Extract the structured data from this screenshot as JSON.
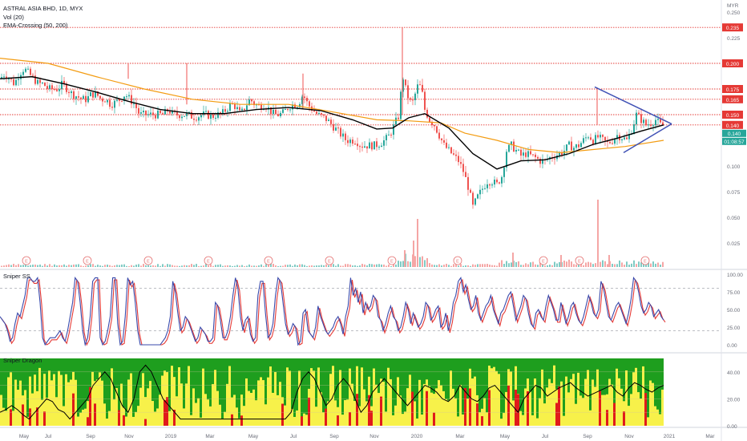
{
  "legend": {
    "symbol": "ASTRAL ASIA BHD, 1D, MYX",
    "vol": "Vol (20)",
    "ema": "EMA-Crossing (50, 200)",
    "sniper": "Sniper SS",
    "dragon": "Sniper Dragon"
  },
  "price_axis": {
    "currency": "MYR",
    "ticks": [
      "0.250",
      "0.225",
      "0.200",
      "0.175",
      "0.150",
      "0.125",
      "0.100",
      "0.075",
      "0.050",
      "0.025"
    ],
    "tick_values": [
      0.25,
      0.225,
      0.2,
      0.175,
      0.15,
      0.125,
      0.1,
      0.075,
      0.05,
      0.025
    ],
    "current_price": "0.140",
    "countdown": "01:08:57"
  },
  "sniper_axis": {
    "ticks": [
      "100.00",
      "75.00",
      "50.00",
      "25.00",
      "0.00"
    ],
    "tick_values": [
      100,
      75,
      50,
      25,
      0
    ]
  },
  "dragon_axis": {
    "ticks": [
      "40.00",
      "20.00",
      "0.00"
    ],
    "tick_values": [
      40,
      20,
      0
    ]
  },
  "time_axis": {
    "labels": [
      "May",
      "Jul",
      "Sep",
      "Nov",
      "2019",
      "Mar",
      "May",
      "Jul",
      "Sep",
      "Nov",
      "2020",
      "Mar",
      "May",
      "Jul",
      "Sep",
      "Nov",
      "2021",
      "Mar"
    ]
  },
  "earnings_marker": "E",
  "colors": {
    "up": "#26a69a",
    "down": "#ef5350",
    "ema_fast": "#000000",
    "ema_slow": "#f39c12",
    "level": "#e53935",
    "trend": "#3f51b5",
    "sniper_a": "#3949ab",
    "sniper_b": "#e53935",
    "dragon_green": "#1e9e1e",
    "dragon_yellow": "#f7f14a",
    "dragon_red": "#e01b1b",
    "price_badge": "#26a69a"
  },
  "chart_data": [
    {
      "type": "candlestick",
      "title": "ASTRAL ASIA BHD, 1D, MYX",
      "ylim": [
        0,
        0.25
      ],
      "levels": [
        {
          "value": 0.235,
          "label": "0.235"
        },
        {
          "value": 0.2,
          "label": "0.200"
        },
        {
          "value": 0.175,
          "label": "0.175"
        },
        {
          "value": 0.165,
          "label": "0.165"
        },
        {
          "value": 0.15,
          "label": "0.150"
        },
        {
          "value": 0.14,
          "label": "0.140"
        }
      ],
      "close_series": [
        [
          0,
          0.185
        ],
        [
          6,
          0.19
        ],
        [
          12,
          0.185
        ],
        [
          18,
          0.18
        ],
        [
          24,
          0.19
        ],
        [
          30,
          0.195
        ],
        [
          36,
          0.19
        ],
        [
          42,
          0.185
        ],
        [
          48,
          0.18
        ],
        [
          54,
          0.18
        ],
        [
          60,
          0.175
        ],
        [
          66,
          0.175
        ],
        [
          72,
          0.175
        ],
        [
          78,
          0.18
        ],
        [
          84,
          0.175
        ],
        [
          90,
          0.17
        ],
        [
          96,
          0.168
        ],
        [
          102,
          0.165
        ],
        [
          108,
          0.165
        ],
        [
          114,
          0.17
        ],
        [
          120,
          0.17
        ],
        [
          126,
          0.165
        ],
        [
          132,
          0.165
        ],
        [
          138,
          0.16
        ],
        [
          144,
          0.162
        ],
        [
          150,
          0.165
        ],
        [
          156,
          0.17
        ],
        [
          162,
          0.165
        ],
        [
          168,
          0.16
        ],
        [
          174,
          0.15
        ],
        [
          180,
          0.15
        ],
        [
          186,
          0.15
        ],
        [
          192,
          0.15
        ],
        [
          198,
          0.15
        ],
        [
          204,
          0.15
        ],
        [
          210,
          0.155
        ],
        [
          216,
          0.15
        ],
        [
          222,
          0.15
        ],
        [
          228,
          0.15
        ],
        [
          234,
          0.15
        ],
        [
          240,
          0.148
        ],
        [
          246,
          0.148
        ],
        [
          252,
          0.15
        ],
        [
          258,
          0.15
        ],
        [
          264,
          0.148
        ],
        [
          270,
          0.15
        ],
        [
          276,
          0.15
        ],
        [
          282,
          0.155
        ],
        [
          288,
          0.16
        ],
        [
          294,
          0.158
        ],
        [
          300,
          0.15
        ],
        [
          306,
          0.158
        ],
        [
          312,
          0.165
        ],
        [
          318,
          0.16
        ],
        [
          324,
          0.158
        ],
        [
          330,
          0.16
        ],
        [
          336,
          0.155
        ],
        [
          342,
          0.15
        ],
        [
          348,
          0.15
        ],
        [
          354,
          0.152
        ],
        [
          360,
          0.158
        ],
        [
          366,
          0.16
        ],
        [
          372,
          0.16
        ],
        [
          378,
          0.17
        ],
        [
          384,
          0.16
        ],
        [
          390,
          0.155
        ],
        [
          396,
          0.15
        ],
        [
          402,
          0.148
        ],
        [
          408,
          0.145
        ],
        [
          414,
          0.14
        ],
        [
          420,
          0.135
        ],
        [
          426,
          0.13
        ],
        [
          432,
          0.125
        ],
        [
          438,
          0.125
        ],
        [
          444,
          0.125
        ],
        [
          450,
          0.12
        ],
        [
          456,
          0.12
        ],
        [
          462,
          0.12
        ],
        [
          468,
          0.12
        ],
        [
          474,
          0.122
        ],
        [
          480,
          0.125
        ],
        [
          486,
          0.13
        ],
        [
          492,
          0.14
        ],
        [
          498,
          0.15
        ],
        [
          502,
          0.19
        ],
        [
          506,
          0.175
        ],
        [
          510,
          0.165
        ],
        [
          514,
          0.16
        ],
        [
          518,
          0.17
        ],
        [
          522,
          0.18
        ],
        [
          526,
          0.175
        ],
        [
          530,
          0.155
        ],
        [
          536,
          0.145
        ],
        [
          542,
          0.14
        ],
        [
          548,
          0.13
        ],
        [
          554,
          0.12
        ],
        [
          560,
          0.115
        ],
        [
          566,
          0.11
        ],
        [
          572,
          0.105
        ],
        [
          578,
          0.095
        ],
        [
          584,
          0.08
        ],
        [
          590,
          0.06
        ],
        [
          596,
          0.07
        ],
        [
          602,
          0.078
        ],
        [
          608,
          0.085
        ],
        [
          614,
          0.085
        ],
        [
          620,
          0.082
        ],
        [
          626,
          0.09
        ],
        [
          632,
          0.115
        ],
        [
          638,
          0.12
        ],
        [
          644,
          0.115
        ],
        [
          650,
          0.11
        ],
        [
          656,
          0.112
        ],
        [
          662,
          0.11
        ],
        [
          668,
          0.108
        ],
        [
          674,
          0.105
        ],
        [
          680,
          0.105
        ],
        [
          686,
          0.108
        ],
        [
          692,
          0.11
        ],
        [
          698,
          0.112
        ],
        [
          704,
          0.115
        ],
        [
          710,
          0.12
        ],
        [
          716,
          0.118
        ],
        [
          722,
          0.12
        ],
        [
          728,
          0.125
        ],
        [
          734,
          0.13
        ],
        [
          740,
          0.125
        ],
        [
          746,
          0.128
        ],
        [
          752,
          0.125
        ],
        [
          758,
          0.122
        ],
        [
          764,
          0.125
        ],
        [
          770,
          0.13
        ],
        [
          776,
          0.128
        ],
        [
          782,
          0.125
        ],
        [
          788,
          0.135
        ],
        [
          794,
          0.15
        ],
        [
          800,
          0.145
        ],
        [
          806,
          0.14
        ],
        [
          812,
          0.142
        ],
        [
          818,
          0.145
        ],
        [
          824,
          0.14
        ],
        [
          828,
          0.14
        ]
      ],
      "ema_50": [
        [
          0,
          0.185
        ],
        [
          40,
          0.187
        ],
        [
          80,
          0.18
        ],
        [
          120,
          0.172
        ],
        [
          160,
          0.163
        ],
        [
          200,
          0.155
        ],
        [
          240,
          0.151
        ],
        [
          280,
          0.151
        ],
        [
          320,
          0.155
        ],
        [
          360,
          0.157
        ],
        [
          400,
          0.154
        ],
        [
          440,
          0.145
        ],
        [
          470,
          0.136
        ],
        [
          490,
          0.137
        ],
        [
          510,
          0.147
        ],
        [
          530,
          0.151
        ],
        [
          560,
          0.137
        ],
        [
          590,
          0.112
        ],
        [
          620,
          0.097
        ],
        [
          650,
          0.105
        ],
        [
          680,
          0.106
        ],
        [
          710,
          0.112
        ],
        [
          740,
          0.121
        ],
        [
          770,
          0.127
        ],
        [
          800,
          0.134
        ],
        [
          828,
          0.14
        ]
      ],
      "ema_200": [
        [
          0,
          0.205
        ],
        [
          60,
          0.2
        ],
        [
          120,
          0.187
        ],
        [
          180,
          0.175
        ],
        [
          240,
          0.165
        ],
        [
          300,
          0.16
        ],
        [
          360,
          0.16
        ],
        [
          420,
          0.152
        ],
        [
          470,
          0.145
        ],
        [
          510,
          0.144
        ],
        [
          550,
          0.142
        ],
        [
          580,
          0.132
        ],
        [
          620,
          0.125
        ],
        [
          660,
          0.116
        ],
        [
          700,
          0.113
        ],
        [
          740,
          0.116
        ],
        [
          780,
          0.119
        ],
        [
          828,
          0.125
        ]
      ],
      "trendlines": [
        {
          "from": [
            742,
            0.177
          ],
          "to": [
            838,
            0.141
          ]
        },
        {
          "from": [
            778,
            0.113
          ],
          "to": [
            838,
            0.141
          ]
        }
      ]
    },
    {
      "type": "bar",
      "title": "Vol (20)",
      "spikes": [
        {
          "x": 521,
          "v": 1.0
        },
        {
          "x": 516,
          "v": 0.55
        },
        {
          "x": 746,
          "v": 1.4
        },
        {
          "x": 505,
          "v": 0.35
        },
        {
          "x": 640,
          "v": 0.3
        },
        {
          "x": 700,
          "v": 0.25
        },
        {
          "x": 760,
          "v": 0.25
        }
      ]
    },
    {
      "type": "line",
      "title": "Sniper SS",
      "ylim": [
        0,
        100
      ],
      "values": [
        40,
        35,
        30,
        20,
        5,
        10,
        30,
        45,
        40,
        55,
        70,
        95,
        95,
        90,
        90,
        95,
        60,
        10,
        0,
        5,
        10,
        10,
        10,
        15,
        20,
        10,
        5,
        20,
        40,
        60,
        95,
        90,
        60,
        20,
        0,
        10,
        40,
        90,
        95,
        95,
        10,
        0,
        5,
        20,
        40,
        95,
        95,
        30,
        0,
        5,
        40,
        95,
        85,
        90,
        60,
        20,
        0,
        0,
        0,
        0,
        0,
        0,
        0,
        0,
        0,
        5,
        10,
        20,
        40,
        90,
        75,
        45,
        20,
        25,
        40,
        35,
        25,
        15,
        5,
        10,
        25,
        20,
        15,
        5,
        5,
        10,
        60,
        55,
        35,
        10,
        10,
        20,
        40,
        70,
        95,
        80,
        40,
        20,
        35,
        40,
        15,
        5,
        10,
        70,
        90,
        90,
        45,
        10,
        15,
        30,
        70,
        95,
        90,
        60,
        30,
        15,
        20,
        30,
        25,
        0,
        5,
        45,
        50,
        20,
        15,
        10,
        25,
        55,
        40,
        30,
        20,
        15,
        20,
        25,
        35,
        40,
        30,
        15,
        40,
        55,
        95,
        70,
        80,
        60,
        75,
        45,
        60,
        50,
        55,
        70,
        65,
        40,
        35,
        20,
        30,
        45,
        55,
        40,
        35,
        20,
        25,
        40,
        60,
        50,
        30,
        45,
        35,
        25,
        30,
        40,
        60,
        55,
        35,
        40,
        50,
        55,
        25,
        30,
        45,
        20,
        35,
        60,
        70,
        90,
        95,
        75,
        85,
        65,
        50,
        55,
        70,
        45,
        35,
        45,
        55,
        60,
        70,
        50,
        40,
        30,
        45,
        50,
        60,
        70,
        75,
        55,
        35,
        45,
        55,
        70,
        65,
        45,
        30,
        25,
        45,
        50,
        40,
        35,
        55,
        70,
        60,
        50,
        35,
        35,
        60,
        45,
        30,
        40,
        55,
        60,
        45,
        35,
        30,
        40,
        55,
        70,
        60,
        45,
        40,
        50,
        90,
        80,
        60,
        40,
        35,
        45,
        55,
        60,
        50,
        40,
        30,
        45,
        65,
        95,
        90,
        75,
        55,
        45,
        50,
        60,
        55,
        40,
        45,
        50,
        40,
        35
      ]
    },
    {
      "type": "heatmap",
      "title": "Sniper Dragon",
      "ylim": [
        0,
        50
      ],
      "line_values": [
        10,
        12,
        15,
        12,
        8,
        5,
        10,
        15,
        20,
        18,
        12,
        10,
        5,
        10,
        15,
        20,
        30,
        35,
        40,
        35,
        25,
        15,
        10,
        20,
        40,
        45,
        40,
        30,
        20,
        15,
        10,
        5,
        5,
        5,
        5,
        5,
        5,
        5,
        5,
        5,
        5,
        5,
        5,
        5,
        5,
        5,
        5,
        5,
        5,
        5,
        10,
        25,
        35,
        40,
        35,
        25,
        15,
        20,
        30,
        35,
        30,
        20,
        10,
        15,
        25,
        30,
        35,
        30,
        25,
        20,
        15,
        20,
        25,
        30,
        28,
        25,
        20,
        18,
        22,
        30,
        25,
        20,
        18,
        22,
        28,
        30,
        25,
        20,
        15,
        10,
        20,
        25,
        30,
        28,
        22,
        25,
        28,
        30,
        32,
        28,
        25,
        22,
        24,
        26,
        28,
        30,
        25,
        22,
        28,
        32,
        30,
        27,
        25,
        28,
        30
      ]
    }
  ]
}
